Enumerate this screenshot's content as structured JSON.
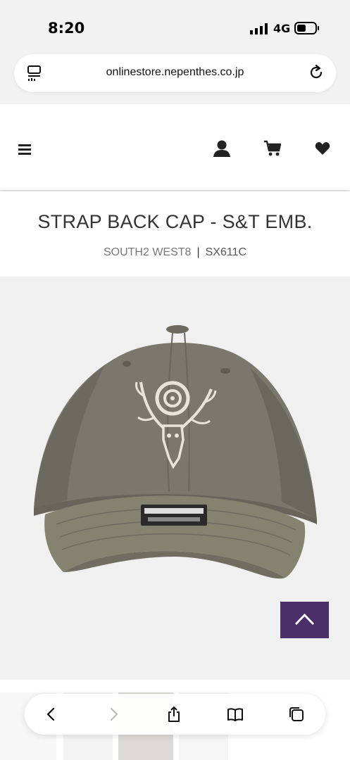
{
  "status_bar": {
    "time": "8:20",
    "network": "4G",
    "signal_icon": "signal-bars-icon",
    "battery_icon": "battery-icon"
  },
  "browser": {
    "url": "onlinestore.nepenthes.co.jp"
  },
  "header": {
    "icons": [
      "menu-icon",
      "user-icon",
      "cart-icon",
      "heart-icon"
    ]
  },
  "product": {
    "title": "STRAP BACK CAP - S&T EMB.",
    "brand": "SOUTH2 WEST8",
    "separator": "|",
    "code": "SX611C"
  },
  "colors": {
    "back_to_top": "#4a2f6b",
    "cap": "#77746a"
  },
  "toolbar": {
    "icons": [
      "back-icon",
      "forward-icon",
      "share-icon",
      "bookmarks-icon",
      "tabs-icon"
    ]
  }
}
